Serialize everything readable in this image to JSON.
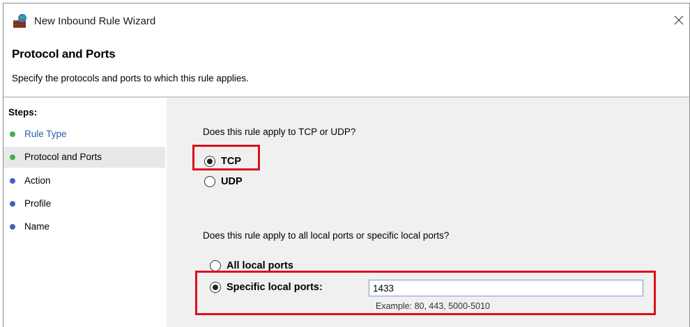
{
  "window": {
    "title": "New Inbound Rule Wizard",
    "icon": "firewall-icon",
    "close_icon": "close-icon"
  },
  "header": {
    "title": "Protocol and Ports",
    "subtitle": "Specify the protocols and ports to which this rule applies."
  },
  "steps": {
    "heading": "Steps:",
    "items": [
      {
        "label": "Rule Type",
        "color": "#2a5fb0",
        "dot": "#3cb34a",
        "selected": false
      },
      {
        "label": "Protocol and Ports",
        "color": "#000000",
        "dot": "#3cb34a",
        "selected": true
      },
      {
        "label": "Action",
        "color": "#000000",
        "dot": "#4a5cc0",
        "selected": false
      },
      {
        "label": "Profile",
        "color": "#000000",
        "dot": "#4a5cc0",
        "selected": false
      },
      {
        "label": "Name",
        "color": "#000000",
        "dot": "#4a5cc0",
        "selected": false
      }
    ]
  },
  "protocol": {
    "question": "Does this rule apply to TCP or UDP?",
    "options": [
      {
        "label": "TCP",
        "checked": true
      },
      {
        "label": "UDP",
        "checked": false
      }
    ]
  },
  "ports": {
    "question": "Does this rule apply to all local ports or specific local ports?",
    "all_label": "All local ports",
    "all_checked": false,
    "specific_label": "Specific local ports:",
    "specific_checked": true,
    "value": "1433",
    "example": "Example: 80, 443, 5000-5010"
  },
  "colors": {
    "highlight": "#d9111c",
    "content_bg": "#f0f0f0",
    "selected_step_bg": "#e8e8e8"
  }
}
